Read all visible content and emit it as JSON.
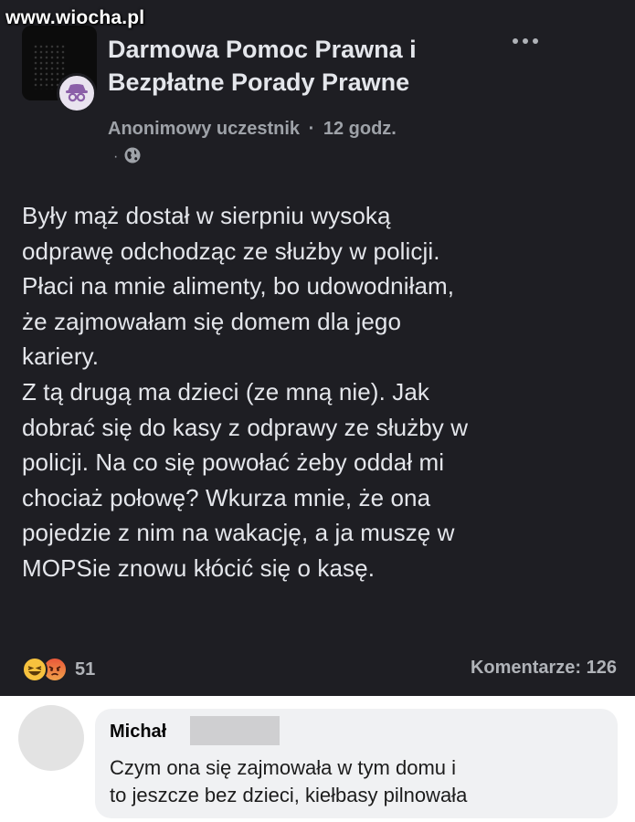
{
  "watermark": "www.wiocha.pl",
  "post": {
    "group_name_line1": "Darmowa Pomoc Prawna i",
    "group_name_line2": "Bezpłatne Porady Prawne",
    "author": "Anonimowy uczestnik",
    "separator": "·",
    "time": "12 godz.",
    "privacy_dot": "·",
    "body_lines": [
      "Były mąż dostał w sierpniu wysoką",
      "odprawę odchodząc ze służby w policji.",
      "Płaci na mnie alimenty, bo udowodniłam,",
      "że zajmowałam się domem dla jego",
      "kariery.",
      "Z tą drugą ma dzieci (ze mną nie). Jak",
      "dobrać się do kasy z odprawy ze służby w",
      "policji. Na co się powołać żeby oddał mi",
      "chociaż połowę? Wkurza mnie, że ona",
      "pojedzie z nim na wakację, a ja muszę w",
      "MOPSie znowu kłócić się o kasę."
    ],
    "reaction_count": "51",
    "comments_label": "Komentarze: 126",
    "reaction_icons": [
      "haha-icon",
      "angry-icon"
    ]
  },
  "comment": {
    "author": "Michał",
    "text_line1": "Czym ona się zajmowała w tym domu i",
    "text_line2": "to jeszcze bez dzieci, kiełbasy pilnowała"
  },
  "colors": {
    "post_background": "#1e1e23",
    "text_primary": "#e4e6eb",
    "text_secondary": "#9ea2a8",
    "comment_background": "#ffffff",
    "bubble_background": "#f0f1f3"
  }
}
